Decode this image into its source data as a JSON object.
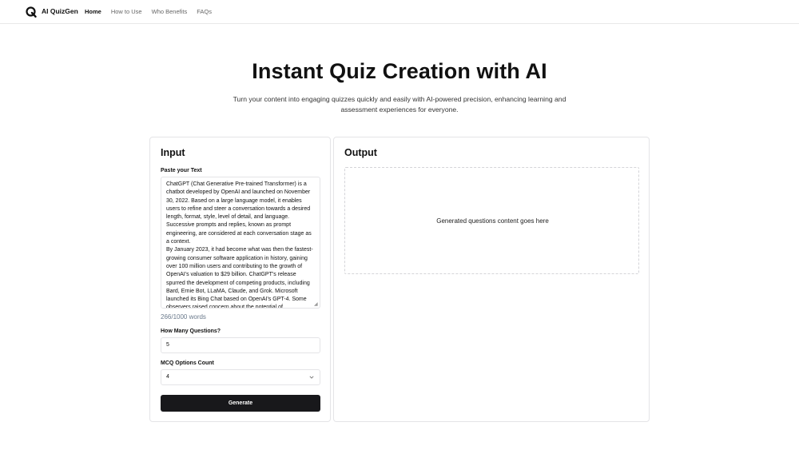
{
  "header": {
    "brand": "AI QuizGen",
    "logo_icon": "quiz-logo-icon",
    "nav": [
      {
        "label": "Home",
        "active": true
      },
      {
        "label": "How to Use",
        "active": false
      },
      {
        "label": "Who Benefits",
        "active": false
      },
      {
        "label": "FAQs",
        "active": false
      }
    ]
  },
  "hero": {
    "title": "Instant Quiz Creation with AI",
    "subtitle": "Turn your content into engaging quizzes quickly and easily with AI-powered precision, enhancing learning and assessment experiences for everyone."
  },
  "input": {
    "title": "Input",
    "text_label": "Paste your Text",
    "text_value": "ChatGPT (Chat Generative Pre-trained Transformer) is a chatbot developed by OpenAI and launched on November 30, 2022. Based on a large language model, it enables users to refine and steer a conversation towards a desired length, format, style, level of detail, and language. Successive prompts and replies, known as prompt engineering, are considered at each conversation stage as a context.\nBy January 2023, it had become what was then the fastest-growing consumer software application in history, gaining over 100 million users and contributing to the growth of OpenAI's valuation to $29 billion. ChatGPT's release spurred the development of competing products, including Bard, Ernie Bot, LLaMA, Claude, and Grok. Microsoft launched its Bing Chat based on OpenAI's GPT-4. Some observers raised concern about the potential of",
    "word_count": "266/1000 words",
    "questions_label": "How Many Questions?",
    "questions_value": "5",
    "mcq_label": "MCQ Options Count",
    "mcq_value": "4",
    "generate_label": "Generate"
  },
  "output": {
    "title": "Output",
    "placeholder": "Generated questions content goes here"
  }
}
